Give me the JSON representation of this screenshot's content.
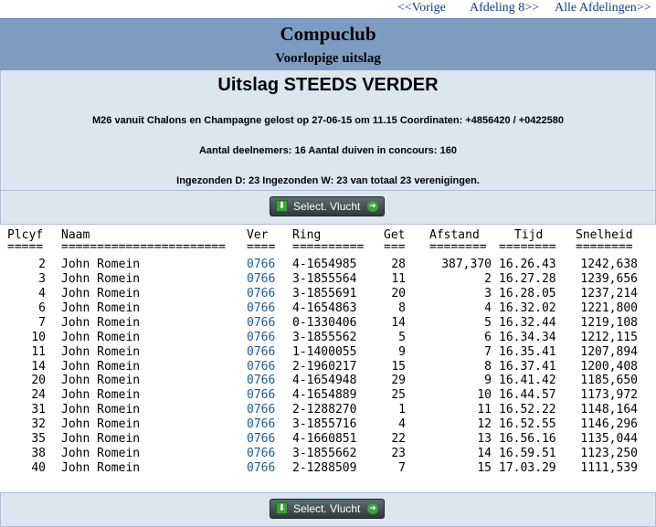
{
  "nav": {
    "prev": "<<Vorige",
    "afdeling": "Afdeling 8>>",
    "alle": "Alle Afdelingen>>"
  },
  "header": {
    "club": "Compuclub",
    "subtitle": "Voorlopige uitslag"
  },
  "info": {
    "title": "Uitslag STEEDS VERDER",
    "line1": "M26 vanuit Chalons en Champagne gelost op 27-06-15 om 11.15 Coordinaten: +4856420 / +0422580",
    "line2": "Aantal deelnemers: 16 Aantal duiven in concours: 160",
    "line3": "Ingezonden D: 23 Ingezonden W: 23 van totaal 23 verenigingen."
  },
  "button": {
    "label": "Select. Vlucht",
    "download_icon": "download-icon",
    "arrow_icon": "arrow-right-icon"
  },
  "table": {
    "headers": {
      "plc": "Plcyf",
      "naam": "Naam",
      "ver": "Ver",
      "ring": "Ring",
      "get": "Get",
      "afstand": "Afstand",
      "tijd": "Tijd",
      "snelheid": "Snelheid"
    },
    "underlines": {
      "plc": "=====",
      "naam": "=======================",
      "ver": "====",
      "ring": "==========",
      "get": "===",
      "afstand": "========",
      "tijd": "========",
      "snelheid": "========"
    },
    "rows": [
      {
        "plc": "2",
        "naam": "John Romein",
        "ver": "0766",
        "ring": "4-1654985",
        "get": "28",
        "afstand": "387,370",
        "tijd": "16.26.43",
        "snelheid": "1242,638"
      },
      {
        "plc": "3",
        "naam": "John Romein",
        "ver": "0766",
        "ring": "3-1855564",
        "get": "11",
        "afstand": "2",
        "tijd": "16.27.28",
        "snelheid": "1239,656"
      },
      {
        "plc": "4",
        "naam": "John Romein",
        "ver": "0766",
        "ring": "3-1855691",
        "get": "20",
        "afstand": "3",
        "tijd": "16.28.05",
        "snelheid": "1237,214"
      },
      {
        "plc": "6",
        "naam": "John Romein",
        "ver": "0766",
        "ring": "4-1654863",
        "get": "8",
        "afstand": "4",
        "tijd": "16.32.02",
        "snelheid": "1221,800"
      },
      {
        "plc": "7",
        "naam": "John Romein",
        "ver": "0766",
        "ring": "0-1330406",
        "get": "14",
        "afstand": "5",
        "tijd": "16.32.44",
        "snelheid": "1219,108"
      },
      {
        "plc": "10",
        "naam": "John Romein",
        "ver": "0766",
        "ring": "3-1855562",
        "get": "5",
        "afstand": "6",
        "tijd": "16.34.34",
        "snelheid": "1212,115"
      },
      {
        "plc": "11",
        "naam": "John Romein",
        "ver": "0766",
        "ring": "1-1400055",
        "get": "9",
        "afstand": "7",
        "tijd": "16.35.41",
        "snelheid": "1207,894"
      },
      {
        "plc": "14",
        "naam": "John Romein",
        "ver": "0766",
        "ring": "2-1960217",
        "get": "15",
        "afstand": "8",
        "tijd": "16.37.41",
        "snelheid": "1200,408"
      },
      {
        "plc": "20",
        "naam": "John Romein",
        "ver": "0766",
        "ring": "4-1654948",
        "get": "29",
        "afstand": "9",
        "tijd": "16.41.42",
        "snelheid": "1185,650"
      },
      {
        "plc": "24",
        "naam": "John Romein",
        "ver": "0766",
        "ring": "4-1654889",
        "get": "25",
        "afstand": "10",
        "tijd": "16.44.57",
        "snelheid": "1173,972"
      },
      {
        "plc": "31",
        "naam": "John Romein",
        "ver": "0766",
        "ring": "2-1288270",
        "get": "1",
        "afstand": "11",
        "tijd": "16.52.22",
        "snelheid": "1148,164"
      },
      {
        "plc": "32",
        "naam": "John Romein",
        "ver": "0766",
        "ring": "3-1855716",
        "get": "4",
        "afstand": "12",
        "tijd": "16.52.55",
        "snelheid": "1146,296"
      },
      {
        "plc": "35",
        "naam": "John Romein",
        "ver": "0766",
        "ring": "4-1660851",
        "get": "22",
        "afstand": "13",
        "tijd": "16.56.16",
        "snelheid": "1135,044"
      },
      {
        "plc": "38",
        "naam": "John Romein",
        "ver": "0766",
        "ring": "3-1855662",
        "get": "23",
        "afstand": "14",
        "tijd": "16.59.51",
        "snelheid": "1123,250"
      },
      {
        "plc": "40",
        "naam": "John Romein",
        "ver": "0766",
        "ring": "2-1288509",
        "get": "7",
        "afstand": "15",
        "tijd": "17.03.29",
        "snelheid": "1111,539"
      }
    ]
  }
}
